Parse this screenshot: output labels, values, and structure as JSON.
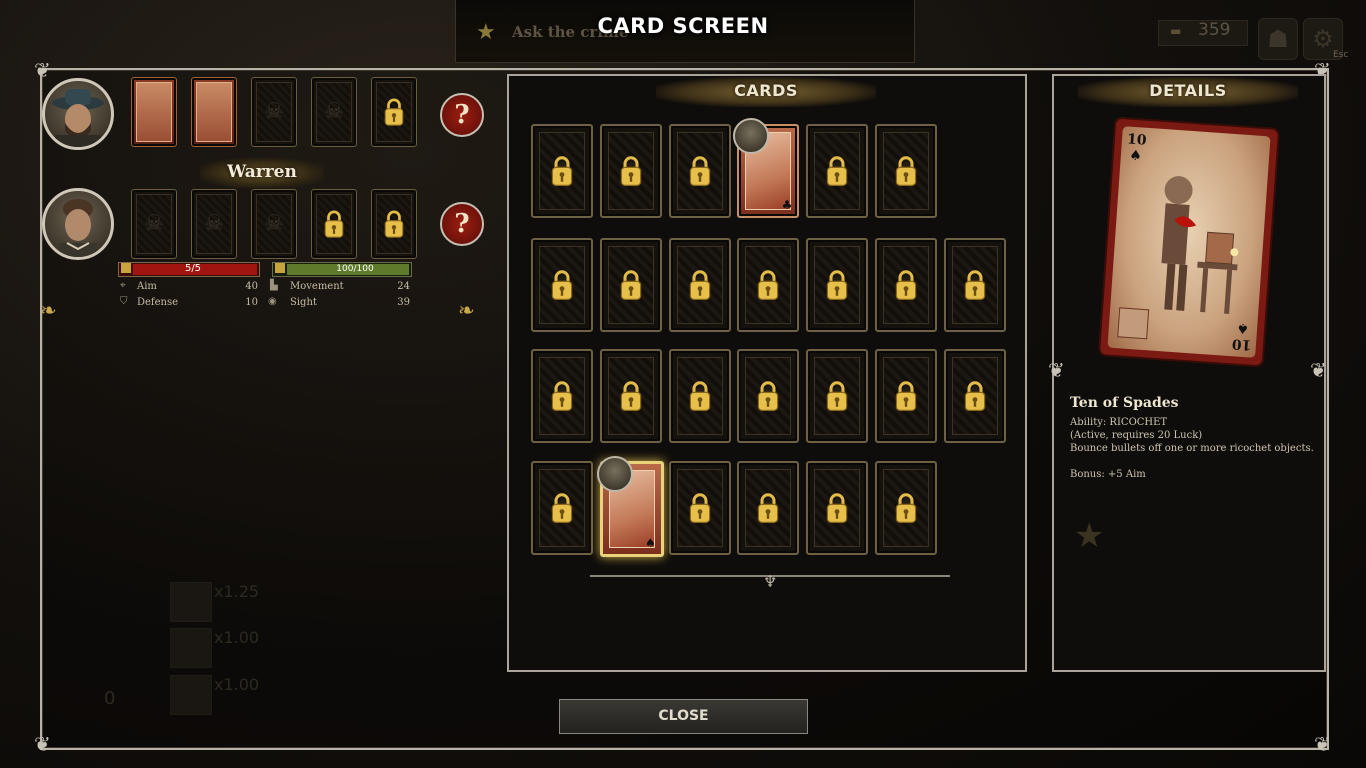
{
  "hud": {
    "screen_title": "CARD SCREEN",
    "objective_text": "Ask the crime",
    "money": "359",
    "esc_label": "Esc"
  },
  "party": {
    "member1": {
      "slots": [
        "equipped",
        "equipped",
        "empty",
        "empty",
        "locked"
      ],
      "help_glyph": "?"
    },
    "member2": {
      "name": "Warren",
      "slots": [
        "empty",
        "empty",
        "empty",
        "locked",
        "locked"
      ],
      "help_glyph": "?",
      "hp_label": "5/5",
      "hp_fraction": 1.0,
      "luck_label": "100/100",
      "luck_fraction": 1.0,
      "stats": [
        {
          "label": "Aim",
          "value": "40"
        },
        {
          "label": "Defense",
          "value": "10"
        },
        {
          "label": "Movement",
          "value": "24"
        },
        {
          "label": "Sight",
          "value": "39"
        }
      ]
    }
  },
  "multipliers": [
    "x1.25",
    "x1.00",
    "x1.00"
  ],
  "ghost_counter": "0",
  "cards_panel": {
    "header": "CARDS",
    "rows": [
      [
        "locked",
        "locked",
        "locked",
        "owned",
        "locked",
        "locked"
      ],
      [
        "locked",
        "locked",
        "locked",
        "locked",
        "locked",
        "locked",
        "locked"
      ],
      [
        "locked",
        "locked",
        "locked",
        "locked",
        "locked",
        "locked",
        "locked"
      ],
      [
        "locked",
        "selected",
        "locked",
        "locked",
        "locked",
        "locked"
      ]
    ]
  },
  "details_panel": {
    "header": "DETAILS",
    "card_rank": "10",
    "card_suit": "♠",
    "title": "Ten of Spades",
    "ability": "Ability: RICOCHET",
    "requirement": "(Active, requires 20 Luck)",
    "description": "Bounce bullets off one or more ricochet objects.",
    "bonus": "Bonus: +5 Aim"
  },
  "close_label": "CLOSE",
  "colors": {
    "gold": "#e9d27a",
    "hp_red": "#a0150f",
    "luck_green": "#5e7a2a",
    "badge_red": "#9b1e12"
  }
}
